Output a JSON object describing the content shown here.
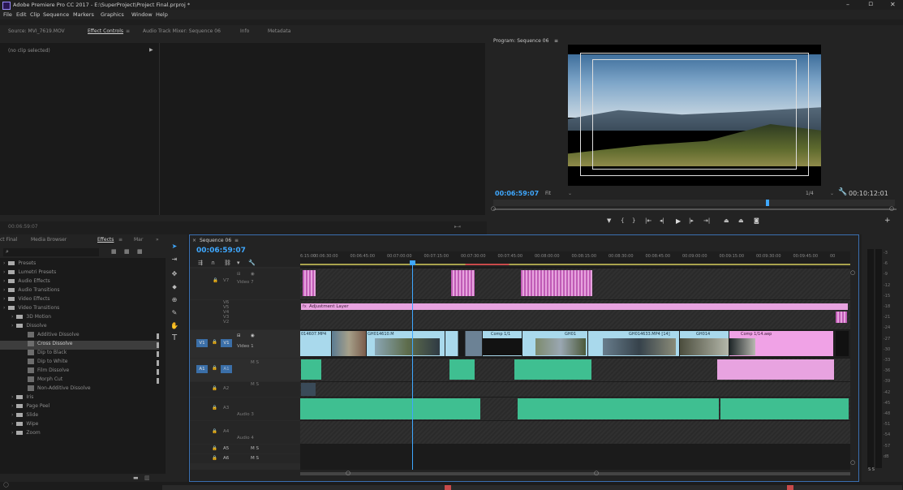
{
  "window": {
    "title": "Adobe Premiere Pro CC 2017 - E:\\SuperProject\\Project Final.prproj *",
    "minimize": "–",
    "maximize": "▫",
    "close": "✕"
  },
  "menu": [
    "File",
    "Edit",
    "Clip",
    "Sequence",
    "Markers",
    "Graphics",
    "Window",
    "Help"
  ],
  "source_panel": {
    "tabs": [
      "Source: MVI_7619.MOV",
      "Effect Controls",
      "≡",
      "Audio Track Mixer: Sequence 06",
      "Info",
      "Metadata"
    ],
    "no_clip": "(no clip selected)",
    "timecode": "00:06:59:07"
  },
  "program_panel": {
    "title": "Program: Sequence 06",
    "menu_glyph": "≡",
    "timecode": "00:06:59:07",
    "fit": "Fit",
    "scale": "1/4",
    "duration": "00:10:12:01"
  },
  "project_panel": {
    "tabs": [
      "ct Final",
      "Media Browser",
      "Effects",
      "≡",
      "Mar",
      "»"
    ],
    "tree": [
      {
        "label": "Presets",
        "indent": 0,
        "kind": "folder"
      },
      {
        "label": "Lumetri Presets",
        "indent": 0,
        "kind": "folder"
      },
      {
        "label": "Audio Effects",
        "indent": 0,
        "kind": "folder"
      },
      {
        "label": "Audio Transitions",
        "indent": 0,
        "kind": "folder"
      },
      {
        "label": "Video Effects",
        "indent": 0,
        "kind": "folder"
      },
      {
        "label": "Video Transitions",
        "indent": 0,
        "kind": "folder"
      },
      {
        "label": "3D Motion",
        "indent": 1,
        "kind": "folder"
      },
      {
        "label": "Dissolve",
        "indent": 1,
        "kind": "folder"
      },
      {
        "label": "Additive Dissolve",
        "indent": 2,
        "kind": "fx"
      },
      {
        "label": "Cross Dissolve",
        "indent": 2,
        "kind": "fx"
      },
      {
        "label": "Dip to Black",
        "indent": 2,
        "kind": "fx"
      },
      {
        "label": "Dip to White",
        "indent": 2,
        "kind": "fx"
      },
      {
        "label": "Film Dissolve",
        "indent": 2,
        "kind": "fx"
      },
      {
        "label": "Morph Cut",
        "indent": 2,
        "kind": "fx"
      },
      {
        "label": "Non-Additive Dissolve",
        "indent": 2,
        "kind": "fx"
      },
      {
        "label": "Iris",
        "indent": 1,
        "kind": "folder"
      },
      {
        "label": "Page Peel",
        "indent": 1,
        "kind": "folder"
      },
      {
        "label": "Slide",
        "indent": 1,
        "kind": "folder"
      },
      {
        "label": "Wipe",
        "indent": 1,
        "kind": "folder"
      },
      {
        "label": "Zoom",
        "indent": 1,
        "kind": "folder"
      }
    ],
    "selected_index": 9
  },
  "timeline": {
    "tab": "Sequence 06",
    "menu_glyph": "≡",
    "timecode": "00:06:59:07",
    "ruler": [
      "6:15:00",
      "00:06:30:00",
      "00:06:45:00",
      "00:07:00:00",
      "00:07:15:00",
      "00:07:30:00",
      "00:07:45:00",
      "00:08:00:00",
      "00:08:15:00",
      "00:08:30:00",
      "00:08:45:00",
      "00:09:00:00",
      "00:09:15:00",
      "00:09:30:00",
      "00:09:45:00",
      "00"
    ],
    "video_tracks": [
      {
        "name": "V7",
        "label": "Video 7"
      },
      {
        "name": "V6"
      },
      {
        "name": "V5"
      },
      {
        "name": "V4"
      },
      {
        "name": "V3"
      },
      {
        "name": "V2"
      },
      {
        "name": "V1",
        "label": "Video 1",
        "source": "V1"
      }
    ],
    "audio_tracks": [
      {
        "name": "A1",
        "source": "A1",
        "label": "M  S"
      },
      {
        "name": "A2",
        "label": "M  S"
      },
      {
        "name": "A3",
        "label": "Audio 3"
      },
      {
        "name": "A4",
        "label": "Audio 4"
      },
      {
        "name": "A5",
        "label": "M  S"
      },
      {
        "name": "A6",
        "label": "M  S"
      }
    ],
    "adjustment": "Adjustment Layer",
    "clip_labels": [
      "014607.MP4",
      "GH014610.M",
      "GH01",
      "Comp 1/1",
      "GH014633.MP4 [14]",
      "GH014",
      "Comp 1/14.aep"
    ],
    "fx_badge": "fx"
  },
  "meter": {
    "scale": [
      "-3",
      "-6",
      "-9",
      "-12",
      "-15",
      "-18",
      "-21",
      "-24",
      "-27",
      "-30",
      "-33",
      "-36",
      "-39",
      "-42",
      "-45",
      "-48",
      "-51",
      "-54",
      "-57",
      "dB"
    ],
    "bottom": "S  S"
  }
}
